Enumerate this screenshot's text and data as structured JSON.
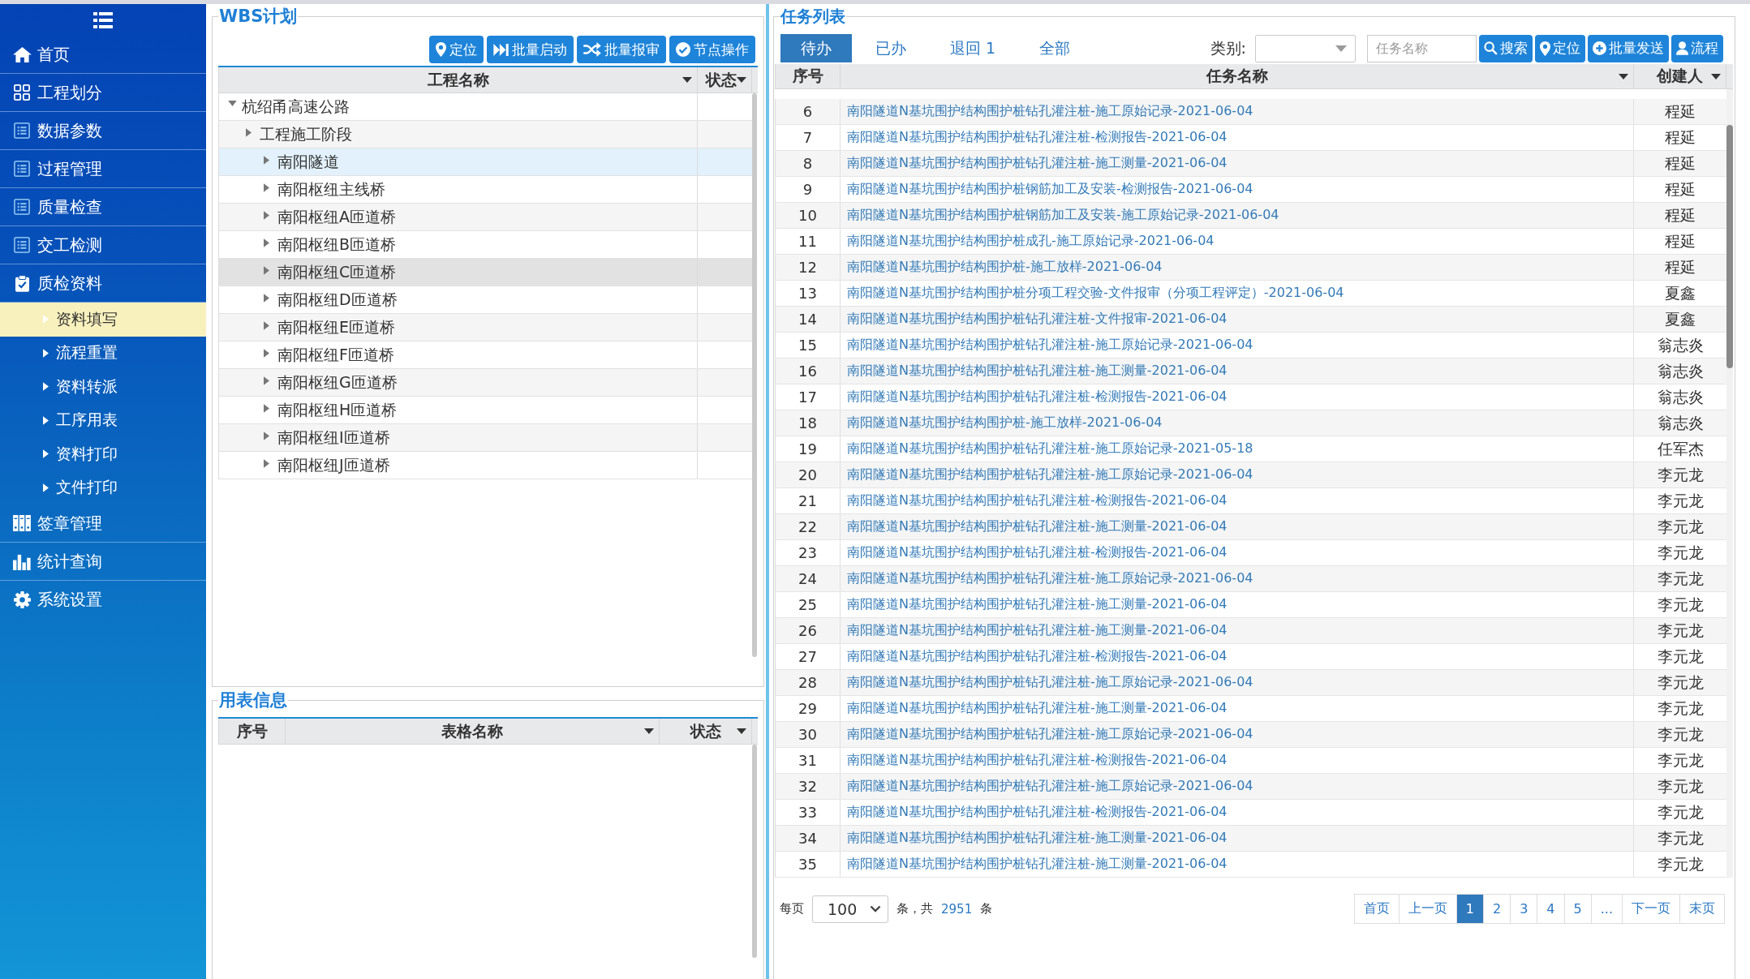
{
  "sidebar": {
    "items": [
      {
        "label": "首页",
        "selected": false
      },
      {
        "label": "工程划分",
        "selected": false
      },
      {
        "label": "数据参数",
        "selected": false
      },
      {
        "label": "过程管理",
        "selected": false
      },
      {
        "label": "质量检查",
        "selected": false
      },
      {
        "label": "交工检测",
        "selected": false
      },
      {
        "label": "质检资料",
        "selected": false,
        "children": [
          {
            "label": "资料填写",
            "selected": true
          },
          {
            "label": "流程重置",
            "selected": false
          },
          {
            "label": "资料转派",
            "selected": false
          },
          {
            "label": "工序用表",
            "selected": false
          },
          {
            "label": "资料打印",
            "selected": false
          },
          {
            "label": "文件打印",
            "selected": false
          }
        ]
      },
      {
        "label": "签章管理",
        "selected": false
      },
      {
        "label": "统计查询",
        "selected": false
      },
      {
        "label": "系统设置",
        "selected": false
      }
    ]
  },
  "wbs_panel": {
    "title": "WBS计划",
    "buttons": [
      "定位",
      "批量启动",
      "批量报审",
      "节点操作"
    ],
    "columns": [
      {
        "label": "工程名称",
        "dropdown": true
      },
      {
        "label": "状态",
        "dropdown": true
      }
    ],
    "tree": [
      {
        "label": "杭绍甬高速公路",
        "expanded": true,
        "selected": false,
        "hovered": false,
        "children": [
          {
            "label": "工程施工阶段",
            "expanded": false,
            "selected": false,
            "hovered": false,
            "children": [
              {
                "label": "南阳隧道",
                "expanded": false,
                "selected": true,
                "hovered": false
              },
              {
                "label": "南阳枢纽主线桥",
                "expanded": false,
                "selected": false,
                "hovered": false
              },
              {
                "label": "南阳枢纽A匝道桥",
                "expanded": false,
                "selected": false,
                "hovered": false
              },
              {
                "label": "南阳枢纽B匝道桥",
                "expanded": false,
                "selected": false,
                "hovered": false
              },
              {
                "label": "南阳枢纽C匝道桥",
                "expanded": false,
                "selected": false,
                "hovered": true
              },
              {
                "label": "南阳枢纽D匝道桥",
                "expanded": false,
                "selected": false,
                "hovered": false
              },
              {
                "label": "南阳枢纽E匝道桥",
                "expanded": false,
                "selected": false,
                "hovered": false
              },
              {
                "label": "南阳枢纽F匝道桥",
                "expanded": false,
                "selected": false,
                "hovered": false
              },
              {
                "label": "南阳枢纽G匝道桥",
                "expanded": false,
                "selected": false,
                "hovered": false
              },
              {
                "label": "南阳枢纽H匝道桥",
                "expanded": false,
                "selected": false,
                "hovered": false
              },
              {
                "label": "南阳枢纽I匝道桥",
                "expanded": false,
                "selected": false,
                "hovered": false
              },
              {
                "label": "南阳枢纽J匝道桥",
                "expanded": false,
                "selected": false,
                "hovered": false
              }
            ]
          }
        ]
      }
    ]
  },
  "forms_panel": {
    "title": "用表信息",
    "columns": [
      {
        "label": "序号",
        "dropdown": false
      },
      {
        "label": "表格名称",
        "dropdown": true
      },
      {
        "label": "状态",
        "dropdown": true
      }
    ]
  },
  "task_panel": {
    "title": "任务列表",
    "tabs": [
      {
        "label": "待办",
        "selected": true
      },
      {
        "label": "已办",
        "selected": false
      },
      {
        "label": "退回 1",
        "selected": false
      },
      {
        "label": "全部",
        "selected": false
      }
    ],
    "category_label": "类别:",
    "search_field": {
      "placeholder": "任务名称"
    },
    "buttons": [
      "搜索",
      "定位",
      "批量发送",
      "流程"
    ],
    "columns": [
      {
        "label": "序号",
        "dropdown": false
      },
      {
        "label": "任务名称",
        "dropdown": true
      },
      {
        "label": "创建人",
        "dropdown": true
      }
    ],
    "rows": [
      {
        "no": "6",
        "name": "南阳隧道N基坑围护结构围护桩钻孔灌注桩-施工原始记录-2021-06-04",
        "creator": "程延"
      },
      {
        "no": "7",
        "name": "南阳隧道N基坑围护结构围护桩钻孔灌注桩-检测报告-2021-06-04",
        "creator": "程延"
      },
      {
        "no": "8",
        "name": "南阳隧道N基坑围护结构围护桩钻孔灌注桩-施工测量-2021-06-04",
        "creator": "程延"
      },
      {
        "no": "9",
        "name": "南阳隧道N基坑围护结构围护桩钢筋加工及安装-检测报告-2021-06-04",
        "creator": "程延"
      },
      {
        "no": "10",
        "name": "南阳隧道N基坑围护结构围护桩钢筋加工及安装-施工原始记录-2021-06-04",
        "creator": "程延"
      },
      {
        "no": "11",
        "name": "南阳隧道N基坑围护结构围护桩成孔-施工原始记录-2021-06-04",
        "creator": "程延"
      },
      {
        "no": "12",
        "name": "南阳隧道N基坑围护结构围护桩-施工放样-2021-06-04",
        "creator": "程延"
      },
      {
        "no": "13",
        "name": "南阳隧道N基坑围护结构围护桩分项工程交验-文件报审（分项工程评定）-2021-06-04",
        "creator": "夏鑫"
      },
      {
        "no": "14",
        "name": "南阳隧道N基坑围护结构围护桩钻孔灌注桩-文件报审-2021-06-04",
        "creator": "夏鑫"
      },
      {
        "no": "15",
        "name": "南阳隧道N基坑围护结构围护桩钻孔灌注桩-施工原始记录-2021-06-04",
        "creator": "翁志炎"
      },
      {
        "no": "16",
        "name": "南阳隧道N基坑围护结构围护桩钻孔灌注桩-施工测量-2021-06-04",
        "creator": "翁志炎"
      },
      {
        "no": "17",
        "name": "南阳隧道N基坑围护结构围护桩钻孔灌注桩-检测报告-2021-06-04",
        "creator": "翁志炎"
      },
      {
        "no": "18",
        "name": "南阳隧道N基坑围护结构围护桩-施工放样-2021-06-04",
        "creator": "翁志炎"
      },
      {
        "no": "19",
        "name": "南阳隧道N基坑围护结构围护桩钻孔灌注桩-施工原始记录-2021-05-18",
        "creator": "任军杰"
      },
      {
        "no": "20",
        "name": "南阳隧道N基坑围护结构围护桩钻孔灌注桩-施工原始记录-2021-06-04",
        "creator": "李元龙"
      },
      {
        "no": "21",
        "name": "南阳隧道N基坑围护结构围护桩钻孔灌注桩-检测报告-2021-06-04",
        "creator": "李元龙"
      },
      {
        "no": "22",
        "name": "南阳隧道N基坑围护结构围护桩钻孔灌注桩-施工测量-2021-06-04",
        "creator": "李元龙"
      },
      {
        "no": "23",
        "name": "南阳隧道N基坑围护结构围护桩钻孔灌注桩-检测报告-2021-06-04",
        "creator": "李元龙"
      },
      {
        "no": "24",
        "name": "南阳隧道N基坑围护结构围护桩钻孔灌注桩-施工原始记录-2021-06-04",
        "creator": "李元龙"
      },
      {
        "no": "25",
        "name": "南阳隧道N基坑围护结构围护桩钻孔灌注桩-施工测量-2021-06-04",
        "creator": "李元龙"
      },
      {
        "no": "26",
        "name": "南阳隧道N基坑围护结构围护桩钻孔灌注桩-施工测量-2021-06-04",
        "creator": "李元龙"
      },
      {
        "no": "27",
        "name": "南阳隧道N基坑围护结构围护桩钻孔灌注桩-检测报告-2021-06-04",
        "creator": "李元龙"
      },
      {
        "no": "28",
        "name": "南阳隧道N基坑围护结构围护桩钻孔灌注桩-施工原始记录-2021-06-04",
        "creator": "李元龙"
      },
      {
        "no": "29",
        "name": "南阳隧道N基坑围护结构围护桩钻孔灌注桩-施工测量-2021-06-04",
        "creator": "李元龙"
      },
      {
        "no": "30",
        "name": "南阳隧道N基坑围护结构围护桩钻孔灌注桩-施工原始记录-2021-06-04",
        "creator": "李元龙"
      },
      {
        "no": "31",
        "name": "南阳隧道N基坑围护结构围护桩钻孔灌注桩-检测报告-2021-06-04",
        "creator": "李元龙"
      },
      {
        "no": "32",
        "name": "南阳隧道N基坑围护结构围护桩钻孔灌注桩-施工原始记录-2021-06-04",
        "creator": "李元龙"
      },
      {
        "no": "33",
        "name": "南阳隧道N基坑围护结构围护桩钻孔灌注桩-检测报告-2021-06-04",
        "creator": "李元龙"
      },
      {
        "no": "34",
        "name": "南阳隧道N基坑围护结构围护桩钻孔灌注桩-施工测量-2021-06-04",
        "creator": "李元龙"
      },
      {
        "no": "35",
        "name": "南阳隧道N基坑围护结构围护桩钻孔灌注桩-施工测量-2021-06-04",
        "creator": "李元龙"
      }
    ],
    "pagination": {
      "per_page_label": "每页",
      "per_page": "100",
      "summary_before": "条，共",
      "total": "2951",
      "summary_after": "条",
      "pages": [
        {
          "label": "首页",
          "selected": false
        },
        {
          "label": "上一页",
          "selected": false
        },
        {
          "label": "1",
          "selected": true
        },
        {
          "label": "2",
          "selected": false
        },
        {
          "label": "3",
          "selected": false
        },
        {
          "label": "4",
          "selected": false
        },
        {
          "label": "5",
          "selected": false
        },
        {
          "label": "...",
          "selected": false
        },
        {
          "label": "下一页",
          "selected": false
        },
        {
          "label": "末页",
          "selected": false
        }
      ]
    }
  }
}
